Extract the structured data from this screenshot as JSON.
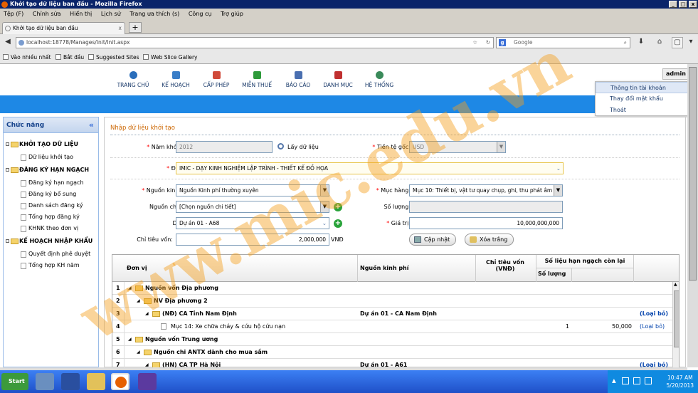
{
  "window": {
    "title": "Khởi tạo dữ liệu ban đầu - Mozilla Firefox",
    "minimize": "_",
    "maximize": "□",
    "close": "x"
  },
  "menubar": [
    "Tệp (F)",
    "Chỉnh sửa",
    "Hiển thị",
    "Lịch sử",
    "Trang ưa thích (s)",
    "Công cụ",
    "Trợ giúp"
  ],
  "tab": {
    "title": "Khởi tạo dữ liệu ban đầu",
    "close": "x",
    "new": "+"
  },
  "nav": {
    "url": "localhost:18778/Manages/Init/Init.aspx",
    "search_placeholder": "Google",
    "back": "◀",
    "forward": "▶"
  },
  "bookmarks": [
    "Vào nhiều nhất",
    "Bắt đầu",
    "Suggested Sites",
    "Web Slice Gallery"
  ],
  "appmenu": [
    {
      "label": "TRANG CHỦ",
      "color": "#2a6ebb"
    },
    {
      "label": "KẾ HOẠCH",
      "color": "#3a7ec8"
    },
    {
      "label": "CẤP PHÉP",
      "color": "#d04a3a"
    },
    {
      "label": "MIỄN THUẾ",
      "color": "#2e9a3a"
    },
    {
      "label": "BÁO CÁO",
      "color": "#4a6fb0"
    },
    {
      "label": "DANH MỤC",
      "color": "#c03030"
    },
    {
      "label": "HỆ THỐNG",
      "color": "#3a8a5a"
    }
  ],
  "user": {
    "name": "admin",
    "menu": [
      "Thông tin tài khoản",
      "Thay đổi mật khẩu",
      "Thoát"
    ]
  },
  "sidebar": {
    "title": "Chức năng",
    "collapse": "«",
    "groups": [
      {
        "label": "KHỞI TẠO DỮ LIỆU",
        "items": [
          "Dữ liệu khởi tạo"
        ]
      },
      {
        "label": "ĐĂNG KÝ HẠN NGẠCH",
        "items": [
          "Đăng ký hạn ngạch",
          "Đăng ký bổ sung",
          "Danh sách đăng ký",
          "Tổng hợp đăng ký",
          "KHNK theo đơn vị"
        ]
      },
      {
        "label": "KẾ HOẠCH NHẬP KHẨU",
        "items": [
          "Quyết định phê duyệt",
          "Tổng hợp KH năm"
        ]
      }
    ]
  },
  "form": {
    "title": "Nhập dữ liệu khởi tạo",
    "nam_label": "Năm khởi tạo:",
    "nam_value": "2012",
    "lay_du_lieu": "Lấy dữ liệu",
    "tiente_label": "Tiền tệ gốc:",
    "tiente_value": "USD",
    "donvi_label": "Đơn vị:",
    "donvi_value": "IMIC - DẠY KINH NGHIỆM LẬP TRÌNH - THIẾT KẾ ĐỒ HỌA",
    "nguonkp_label": "Nguồn kinh phí:",
    "nguonkp_value": "Nguồn Kinh phí thường xuyên",
    "muchang_label": "Mục hàng:",
    "muchang_value": "Mục 10: Thiết bị, vật tư quay chụp, ghi, thu phát âm",
    "nguonct_label": "Nguồn chi tiết:",
    "nguonct_value": "[Chọn nguồn chi tiết]",
    "soluong_label": "Số lượng:",
    "soluong_value": "",
    "duan_label": "Dự án:",
    "duan_value": "Dự án 01 - A68",
    "giatri_label": "Giá trị:",
    "giatri_value": "10,000,000,000",
    "chitieu_label": "Chỉ tiêu vốn:",
    "chitieu_value": "2,000,000",
    "chitieu_unit": "VNĐ",
    "capnhat": "Cập nhật",
    "xoatrang": "Xóa trắng",
    "required_mark": "*"
  },
  "grid": {
    "headers": {
      "donvi": "Đơn vị",
      "nguonkp": "Nguồn kinh phí",
      "chitieu": "Chỉ tiêu vốn (VNĐ)",
      "solieu": "Số liệu hạn ngạch còn lại",
      "soluong": "Số lượng"
    },
    "rows": [
      {
        "no": "1",
        "indent": 0,
        "icon": "folder",
        "text": "Nguồn vốn Địa phương",
        "bold": true,
        "nguon": "",
        "sl": "",
        "gt": "",
        "action": ""
      },
      {
        "no": "2",
        "indent": 1,
        "icon": "folder",
        "text": "NV Địa phương 2",
        "bold": true,
        "nguon": "",
        "sl": "",
        "gt": "",
        "action": ""
      },
      {
        "no": "3",
        "indent": 2,
        "icon": "folder",
        "text": "(NĐ) CA Tỉnh Nam Định",
        "bold": true,
        "nguon": "Dự án 01 - CA Nam Định",
        "sl": "",
        "gt": "",
        "action": "(Loại bỏ)"
      },
      {
        "no": "4",
        "indent": 3,
        "icon": "doc",
        "text": "Mục 14: Xe chữa cháy & cứu hộ cứu nạn",
        "bold": false,
        "nguon": "",
        "sl": "1",
        "gt": "50,000",
        "action": "(Loại bỏ)"
      },
      {
        "no": "5",
        "indent": 0,
        "icon": "folder",
        "text": "Nguồn vốn Trung ương",
        "bold": true,
        "nguon": "",
        "sl": "",
        "gt": "",
        "action": ""
      },
      {
        "no": "6",
        "indent": 1,
        "icon": "folder",
        "text": "Nguồn chi ANTX dành cho mua sắm",
        "bold": true,
        "nguon": "",
        "sl": "",
        "gt": "",
        "action": ""
      },
      {
        "no": "7",
        "indent": 2,
        "icon": "folder",
        "text": "(HN) CA TP Hà Nội",
        "bold": true,
        "nguon": "Dự án 01 - A61",
        "sl": "",
        "gt": "",
        "action": "(Loại bỏ)"
      }
    ]
  },
  "taskbar": {
    "start": "Start",
    "time": "10:47 AM",
    "date": "5/20/2013"
  },
  "watermark": "www.mic.edu.vn"
}
